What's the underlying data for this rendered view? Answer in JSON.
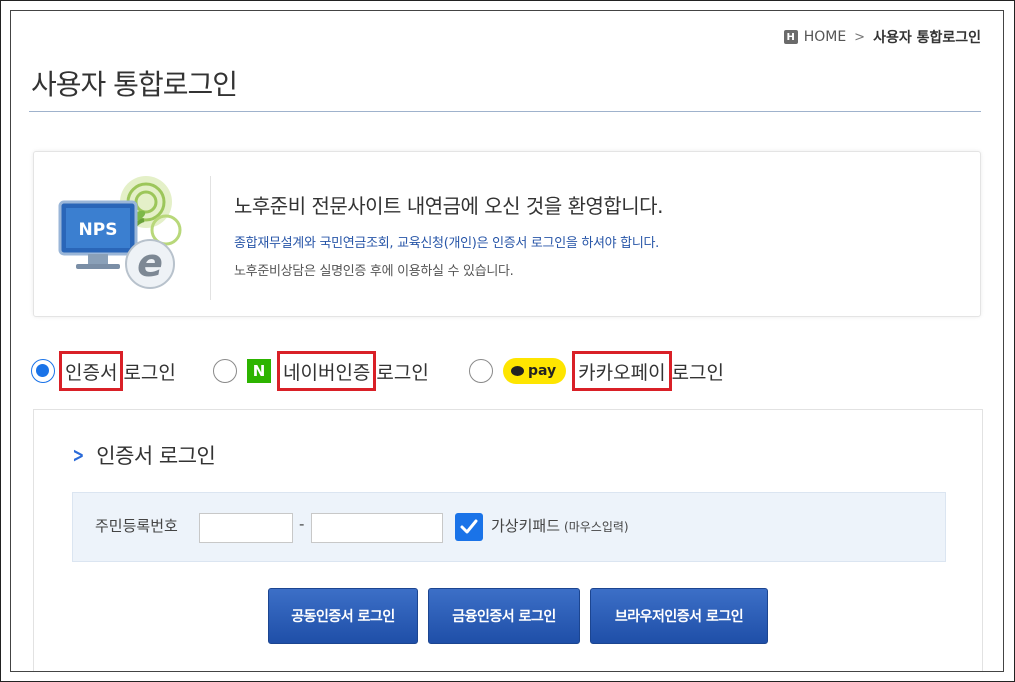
{
  "breadcrumb": {
    "home_label": "HOME",
    "home_icon": "home-icon",
    "separator": ">",
    "current": "사용자 통합로그인"
  },
  "page_title": "사용자 통합로그인",
  "welcome": {
    "logo_text": "NPS",
    "heading": "노후준비 전문사이트 내연금에 오신 것을 환영합니다.",
    "info": "종합재무설계와 국민연금조회, 교육신청(개인)은 인증서 로그인을 하셔야 합니다.",
    "note": "노후준비상담은 실명인증 후에 이용하실 수 있습니다."
  },
  "login_methods": [
    {
      "id": "cert",
      "highlight": "인증서",
      "suffix": "로그인",
      "selected": true
    },
    {
      "id": "naver",
      "icon_text": "N",
      "highlight": "네이버인증",
      "suffix": "로그인",
      "selected": false
    },
    {
      "id": "kakao",
      "icon_text": "pay",
      "highlight": "카카오페이",
      "suffix": "로그인",
      "selected": false
    }
  ],
  "panel": {
    "title": "인증서 로그인",
    "rrn_label": "주민등록번호",
    "rrn_first_value": "",
    "rrn_second_value": "",
    "dash": "-",
    "virtual_keypad_label": "가상키패드",
    "virtual_keypad_sub": "(마우스입력)",
    "virtual_keypad_checked": true,
    "buttons": {
      "joint_cert": "공동인증서 로그인",
      "finance_cert": "금융인증서 로그인",
      "browser_cert": "브라우저인증서 로그인"
    }
  },
  "colors": {
    "accent_blue": "#1a73e8",
    "button_blue": "#2a5cb6",
    "highlight_red": "#d92027",
    "naver_green": "#2db400",
    "kakao_yellow": "#fee500",
    "info_text_blue": "#2856a8"
  }
}
